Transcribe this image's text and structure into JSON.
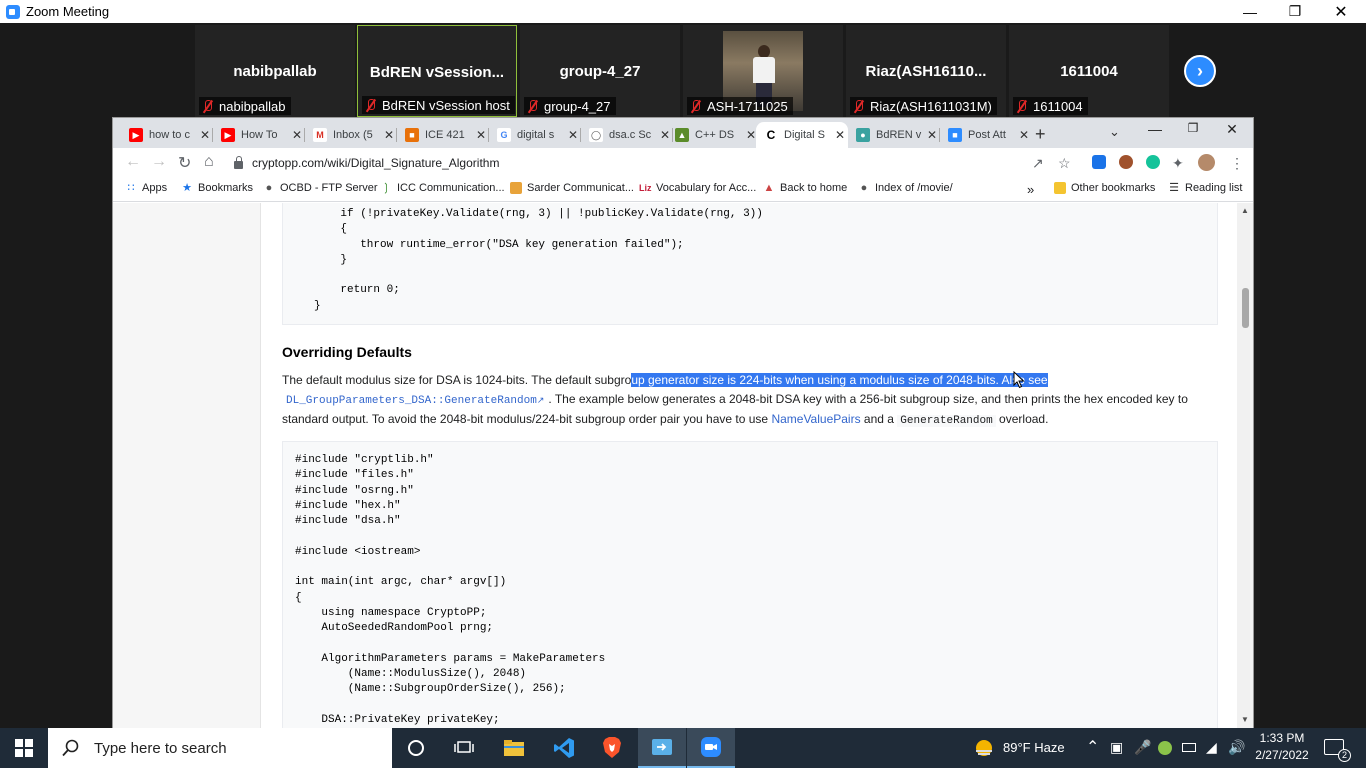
{
  "zoom": {
    "title": "Zoom Meeting",
    "participants": [
      {
        "name": "nabibpallab",
        "label": "nabibpallab"
      },
      {
        "name": "BdREN  vSession...",
        "label": "BdREN vSession host"
      },
      {
        "name": "group-4_27",
        "label": "group-4_27"
      },
      {
        "name": "",
        "label": "ASH-1711025"
      },
      {
        "name": "Riaz(ASH16110...",
        "label": "Riaz(ASH1611031M)"
      },
      {
        "name": "1611004",
        "label": "1611004"
      }
    ]
  },
  "browser": {
    "tabs": [
      {
        "label": "how to c",
        "icon": "youtube-icon"
      },
      {
        "label": "How To",
        "icon": "youtube-icon"
      },
      {
        "label": "Inbox (5",
        "icon": "gmail-icon"
      },
      {
        "label": "ICE 421",
        "icon": "classroom-icon"
      },
      {
        "label": "digital s",
        "icon": "google-icon"
      },
      {
        "label": "dsa.c Sc",
        "icon": "globe-icon"
      },
      {
        "label": "C++ DS",
        "icon": "cplusplus-icon"
      },
      {
        "label": "Digital S",
        "icon": "cryptopp-icon"
      },
      {
        "label": "BdREN v",
        "icon": "bdren-icon"
      },
      {
        "label": "Post Att",
        "icon": "zoom-icon"
      }
    ],
    "url": "cryptopp.com/wiki/Digital_Signature_Algorithm",
    "bookmarks": [
      "Apps",
      "Bookmarks",
      "OCBD - FTP Server",
      "ICC Communication...",
      "Sarder Communicat...",
      "Vocabulary for Acc...",
      "Back to home",
      "Index of /movie/"
    ],
    "bookmarks_more": "»",
    "other_bookmarks": "Other bookmarks",
    "reading_list": "Reading list"
  },
  "page": {
    "code_top": [
      "    if (!privateKey.Validate(rng, 3) || !publicKey.Validate(rng, 3))",
      "    {",
      "       throw runtime_error(\"DSA key generation failed\");",
      "    }",
      "",
      "    return 0;",
      "}"
    ],
    "heading": "Overriding Defaults",
    "para1_a": "The default modulus size for DSA is 1024-bits. The default subgro",
    "para1_hl": "up generator size is 224-bits when using a modulus size of 2048-bits. Also see",
    "para2_code": "DL_GroupParameters_DSA::GenerateRandom",
    "para2_rest": ". The example below generates a 2048-bit DSA key with a 256-bit subgroup size, and then prints the hex encoded key to",
    "para3_a": "standard output. To avoid the 2048-bit modulus/224-bit subgroup order pair you have to use ",
    "para3_link": "NameValuePairs",
    "para3_b": " and a ",
    "para3_code": "GenerateRandom",
    "para3_c": " overload.",
    "code_main": [
      "#include \"cryptlib.h\"",
      "#include \"files.h\"",
      "#include \"osrng.h\"",
      "#include \"hex.h\"",
      "#include \"dsa.h\"",
      "",
      "#include <iostream>",
      "",
      "int main(int argc, char* argv[])",
      "{",
      "    using namespace CryptoPP;",
      "    AutoSeededRandomPool prng;",
      "",
      "    AlgorithmParameters params = MakeParameters",
      "        (Name::ModulusSize(), 2048)",
      "        (Name::SubgroupOrderSize(), 256);",
      "",
      "    DSA::PrivateKey privateKey;"
    ]
  },
  "taskbar": {
    "search_placeholder": "Type here to search",
    "weather": "89°F  Haze",
    "time": "1:33 PM",
    "date": "2/27/2022",
    "notifications": "2"
  }
}
